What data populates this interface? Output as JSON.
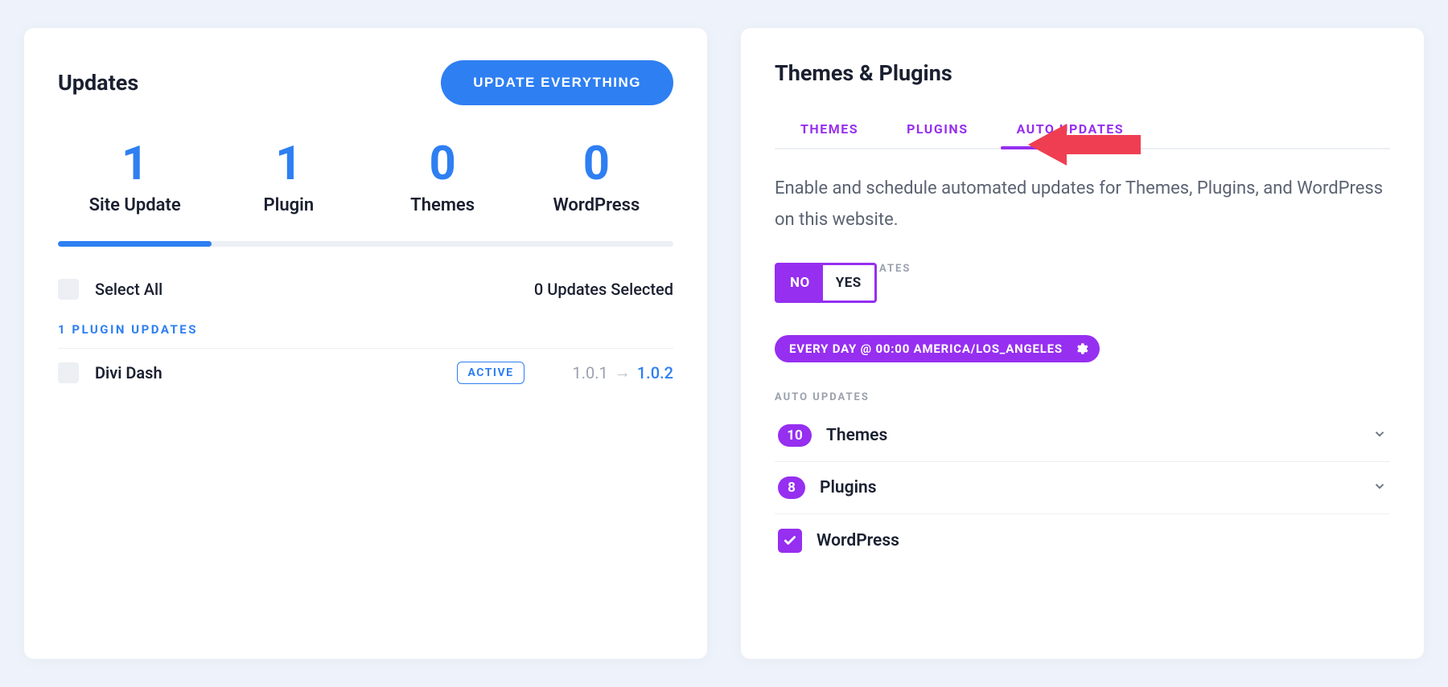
{
  "updates": {
    "title": "Updates",
    "update_button": "UPDATE EVERYTHING",
    "stats": [
      {
        "number": "1",
        "label": "Site Update"
      },
      {
        "number": "1",
        "label": "Plugin"
      },
      {
        "number": "0",
        "label": "Themes"
      },
      {
        "number": "0",
        "label": "WordPress"
      }
    ],
    "select_all": "Select All",
    "selected_text": "0 Updates Selected",
    "plugin_section": "1 PLUGIN UPDATES",
    "items": [
      {
        "name": "Divi Dash",
        "status": "ACTIVE",
        "old": "1.0.1",
        "new": "1.0.2"
      }
    ]
  },
  "themes_plugins": {
    "title": "Themes & Plugins",
    "tabs": {
      "themes": "THEMES",
      "plugins": "PLUGINS",
      "auto": "AUTO UPDATES"
    },
    "description": "Enable and schedule automated updates for Themes, Plugins, and WordPress on this website.",
    "enable_label": "ATES",
    "toggle": {
      "no": "NO",
      "yes": "YES"
    },
    "schedule_text": "EVERY DAY @ 00:00  AMERICA/LOS_ANGELES",
    "auto_updates_label": "AUTO UPDATES",
    "rows": {
      "themes": {
        "count": "10",
        "label": "Themes"
      },
      "plugins": {
        "count": "8",
        "label": "Plugins"
      },
      "wordpress": {
        "label": "WordPress"
      }
    }
  },
  "colors": {
    "blue": "#2e7ff2",
    "purple": "#962ff0",
    "red": "#ef3e52"
  }
}
